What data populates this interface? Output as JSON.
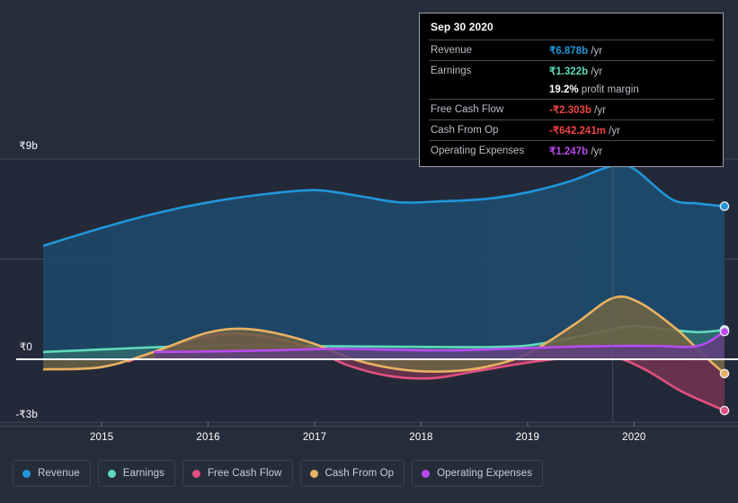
{
  "chart_data": {
    "type": "area",
    "title": "",
    "xlabel": "",
    "ylabel": "",
    "currency": "₹",
    "grid": true,
    "legend_position": "bottom",
    "xlim": [
      2014.45,
      2020.85
    ],
    "ylim": [
      -3,
      9
    ],
    "x_ticks": [
      "2015",
      "2016",
      "2017",
      "2018",
      "2019",
      "2020"
    ],
    "x_tick_values": [
      2015,
      2016,
      2017,
      2018,
      2019,
      2020
    ],
    "y_ticks": [
      "₹9b",
      "₹0",
      "-₹3b"
    ],
    "y_tick_values": [
      9,
      0,
      -3
    ],
    "zero_line": 0,
    "forecast_divider_x": 2019.8,
    "series": [
      {
        "name": "Revenue",
        "color": "#2196d9",
        "fill": "#1d4b6e",
        "x": [
          2014.45,
          2015.0,
          2015.5,
          2016.0,
          2016.5,
          2017.0,
          2017.4,
          2017.8,
          2018.2,
          2018.6,
          2019.0,
          2019.4,
          2019.8,
          2020.0,
          2020.35,
          2020.6,
          2020.85
        ],
        "values": [
          5.1,
          5.9,
          6.55,
          7.05,
          7.4,
          7.6,
          7.35,
          7.05,
          7.1,
          7.2,
          7.5,
          8.0,
          8.7,
          8.55,
          7.2,
          7.0,
          6.878
        ]
      },
      {
        "name": "Earnings",
        "color": "#5fdbba",
        "fill": "#2f6a6e",
        "x": [
          2014.45,
          2015.0,
          2015.6,
          2016.2,
          2016.8,
          2017.4,
          2018.0,
          2018.6,
          2019.0,
          2019.4,
          2019.8,
          2020.0,
          2020.3,
          2020.6,
          2020.85
        ],
        "values": [
          0.33,
          0.44,
          0.56,
          0.63,
          0.6,
          0.58,
          0.56,
          0.55,
          0.62,
          0.95,
          1.35,
          1.5,
          1.35,
          1.22,
          1.322
        ]
      },
      {
        "name": "Free Cash Flow",
        "color": "#e0507e",
        "fill": "#6e3350",
        "x": [
          2015.25,
          2015.6,
          2016.0,
          2016.4,
          2016.9,
          2017.3,
          2017.7,
          2018.1,
          2018.5,
          2019.0,
          2019.4,
          2019.8,
          2020.1,
          2020.45,
          2020.85
        ],
        "values": [
          -0.1,
          0.5,
          1.05,
          1.12,
          0.6,
          -0.25,
          -0.75,
          -0.85,
          -0.55,
          -0.15,
          0.07,
          0.1,
          -0.45,
          -1.45,
          -2.303
        ]
      },
      {
        "name": "Cash From Op",
        "color": "#e8b263",
        "fill": "#6b6344",
        "x": [
          2014.45,
          2015.0,
          2015.5,
          2016.0,
          2016.4,
          2016.9,
          2017.4,
          2017.8,
          2018.2,
          2018.6,
          2019.0,
          2019.45,
          2019.8,
          2020.05,
          2020.4,
          2020.65,
          2020.85
        ],
        "values": [
          -0.45,
          -0.35,
          0.35,
          1.2,
          1.35,
          0.85,
          -0.05,
          -0.45,
          -0.55,
          -0.35,
          0.25,
          1.6,
          2.75,
          2.55,
          1.35,
          0.2,
          -0.642
        ]
      },
      {
        "name": "Operating Expenses",
        "color": "#b84bf0",
        "fill": "#5d3f7e",
        "x": [
          2015.5,
          2016.0,
          2016.6,
          2017.2,
          2017.8,
          2018.3,
          2018.8,
          2019.3,
          2019.8,
          2020.2,
          2020.6,
          2020.85
        ],
        "values": [
          0.33,
          0.35,
          0.4,
          0.47,
          0.42,
          0.4,
          0.47,
          0.55,
          0.6,
          0.6,
          0.6,
          1.247
        ]
      }
    ]
  },
  "tooltip": {
    "title": "Sep 30 2020",
    "rows": [
      {
        "label": "Revenue",
        "value": "₹6.878b",
        "unit": "/yr",
        "color": "#2196d9",
        "rule": true
      },
      {
        "label": "Earnings",
        "value": "₹1.322b",
        "unit": "/yr",
        "color": "#5fdbba",
        "rule": true
      },
      {
        "label": "",
        "value": "19.2%",
        "unit": "profit margin",
        "color": "#ffffff",
        "rule": false
      },
      {
        "label": "Free Cash Flow",
        "value": "-₹2.303b",
        "unit": "/yr",
        "color": "#ef4444",
        "rule": true
      },
      {
        "label": "Cash From Op",
        "value": "-₹642.241m",
        "unit": "/yr",
        "color": "#ef4444",
        "rule": true
      },
      {
        "label": "Operating Expenses",
        "value": "₹1.247b",
        "unit": "/yr",
        "color": "#b84bf0",
        "rule": true
      }
    ]
  },
  "legend": {
    "items": [
      {
        "label": "Revenue",
        "color": "#2196d9"
      },
      {
        "label": "Earnings",
        "color": "#5fdbba"
      },
      {
        "label": "Free Cash Flow",
        "color": "#e0507e"
      },
      {
        "label": "Cash From Op",
        "color": "#e8b263"
      },
      {
        "label": "Operating Expenses",
        "color": "#b84bf0"
      }
    ]
  },
  "colors": {
    "page_background": "#262d3a",
    "plot_background": "#232938",
    "gridline": "#3f4758",
    "zero_line": "#ffffff",
    "axis_text": "#ffffff"
  }
}
